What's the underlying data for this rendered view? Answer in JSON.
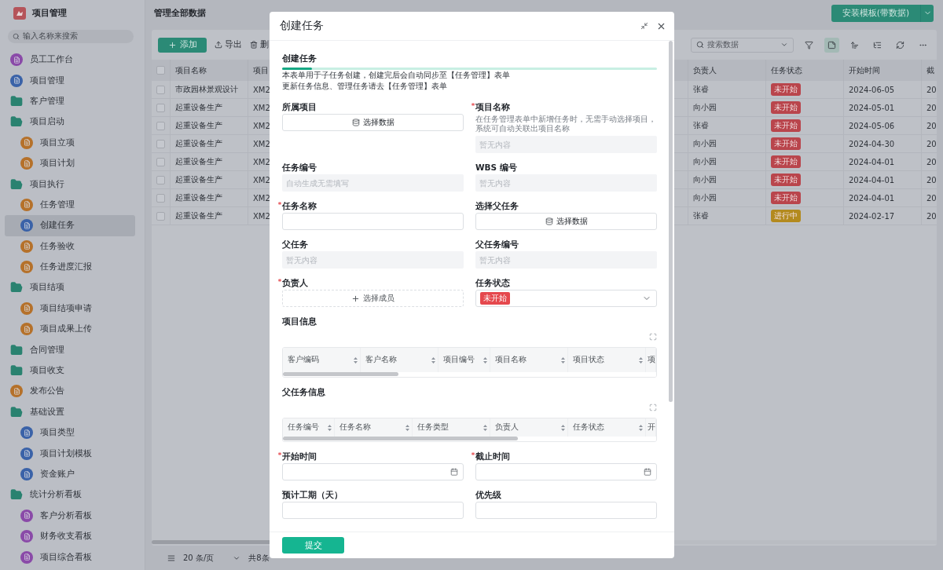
{
  "sidebar": {
    "title": "项目管理",
    "search": {
      "placeholder": "输入名称来搜索"
    },
    "items": [
      {
        "kind": "page",
        "label": "员工工作台",
        "color": "#8a4aa8",
        "selected": false
      },
      {
        "kind": "page",
        "label": "项目管理",
        "color": "#3a62a8",
        "selected": false
      },
      {
        "kind": "folder",
        "label": "客户管理",
        "expanded": false,
        "selected": false
      },
      {
        "kind": "folder",
        "label": "项目启动",
        "expanded": true,
        "selected": false,
        "children": [
          {
            "kind": "page",
            "label": "项目立项",
            "color": "#b5712a",
            "selected": false
          },
          {
            "kind": "page",
            "label": "项目计划",
            "color": "#b5712a",
            "selected": false
          }
        ]
      },
      {
        "kind": "folder",
        "label": "项目执行",
        "expanded": true,
        "selected": false,
        "children": [
          {
            "kind": "page",
            "label": "任务管理",
            "color": "#b5712a",
            "selected": false
          },
          {
            "kind": "page",
            "label": "创建任务",
            "color": "#3a62a8",
            "selected": true
          },
          {
            "kind": "page",
            "label": "任务验收",
            "color": "#b5712a",
            "selected": false
          },
          {
            "kind": "page",
            "label": "任务进度汇报",
            "color": "#b5712a",
            "selected": false
          }
        ]
      },
      {
        "kind": "folder",
        "label": "项目结项",
        "expanded": true,
        "selected": false,
        "children": [
          {
            "kind": "page",
            "label": "项目结项申请",
            "color": "#b5712a",
            "selected": false
          },
          {
            "kind": "page",
            "label": "项目成果上传",
            "color": "#b5712a",
            "selected": false
          }
        ]
      },
      {
        "kind": "folder",
        "label": "合同管理",
        "expanded": false,
        "selected": false
      },
      {
        "kind": "folder",
        "label": "项目收支",
        "expanded": false,
        "selected": false
      },
      {
        "kind": "page",
        "label": "发布公告",
        "color": "#b5712a",
        "selected": false
      },
      {
        "kind": "folder",
        "label": "基础设置",
        "expanded": true,
        "selected": false,
        "children": [
          {
            "kind": "page",
            "label": "项目类型",
            "color": "#3a62a8",
            "selected": false
          },
          {
            "kind": "page",
            "label": "项目计划模板",
            "color": "#3a62a8",
            "selected": false
          },
          {
            "kind": "page",
            "label": "资金账户",
            "color": "#3a62a8",
            "selected": false
          }
        ]
      },
      {
        "kind": "folder",
        "label": "统计分析看板",
        "expanded": true,
        "selected": false,
        "children": [
          {
            "kind": "page",
            "label": "客户分析看板",
            "color": "#8a4aa8",
            "selected": false
          },
          {
            "kind": "page",
            "label": "财务收支看板",
            "color": "#8a4aa8",
            "selected": false
          },
          {
            "kind": "page",
            "label": "项目综合看板",
            "color": "#8a4aa8",
            "selected": false
          }
        ]
      }
    ]
  },
  "header": {
    "title": "管理全部数据",
    "install_button": "安装模板(带数据)"
  },
  "toolbar": {
    "add": "添加",
    "export": "导出",
    "delete": "删",
    "search": {
      "placeholder": "搜索数据"
    },
    "view_toggle": {
      "on": true
    }
  },
  "table": {
    "header_checkbox": {
      "checked": false
    },
    "columns": [
      "项目名称",
      "项目",
      "负责人",
      "任务状态",
      "开始时间",
      "截"
    ],
    "rows": [
      {
        "checked": false,
        "name": "市政园林景观设计",
        "code": "XM2",
        "owner": "张睿",
        "status": {
          "text": "未开始",
          "color": "#b9454c"
        },
        "start": "2024-06-05",
        "end": "20"
      },
      {
        "checked": false,
        "name": "起重设备生产",
        "code": "XM2",
        "owner": "向小园",
        "status": {
          "text": "未开始",
          "color": "#b9454c"
        },
        "start": "2024-05-01",
        "end": "20"
      },
      {
        "checked": false,
        "name": "起重设备生产",
        "code": "XM2",
        "owner": "张睿",
        "status": {
          "text": "未开始",
          "color": "#b9454c"
        },
        "start": "2024-05-06",
        "end": "20"
      },
      {
        "checked": false,
        "name": "起重设备生产",
        "code": "XM2",
        "owner": "向小园",
        "status": {
          "text": "未开始",
          "color": "#b9454c"
        },
        "start": "2024-04-30",
        "end": "20"
      },
      {
        "checked": false,
        "name": "起重设备生产",
        "code": "XM2",
        "owner": "向小园",
        "status": {
          "text": "未开始",
          "color": "#b9454c"
        },
        "start": "2024-04-01",
        "end": "20"
      },
      {
        "checked": false,
        "name": "起重设备生产",
        "code": "XM2",
        "owner": "向小园",
        "status": {
          "text": "未开始",
          "color": "#b9454c"
        },
        "start": "2024-04-01",
        "end": "20"
      },
      {
        "checked": false,
        "name": "起重设备生产",
        "code": "XM2",
        "owner": "向小园",
        "status": {
          "text": "未开始",
          "color": "#b9454c"
        },
        "start": "2024-04-01",
        "end": "20"
      },
      {
        "checked": false,
        "name": "起重设备生产",
        "code": "XM2",
        "owner": "张睿",
        "status": {
          "text": "进行中",
          "color": "#b38a1e"
        },
        "start": "2024-02-17",
        "end": "20"
      }
    ]
  },
  "pagination": {
    "page_size": "20 条/页",
    "total": "共8条"
  },
  "dialog": {
    "title": "创建任务",
    "section": "创建任务",
    "description": [
      "本表单用于子任务创建，创建完后会自动同步至【任务管理】表单",
      "更新任务信息、管理任务请去【任务管理】表单"
    ],
    "fields": [
      {
        "kind": "picker",
        "label": "所属项目",
        "required": false,
        "button": "选择数据"
      },
      {
        "kind": "readonly",
        "label": "项目名称",
        "required": true,
        "hint": "在任务管理表单中新增任务时，无需手动选择项目，系统可自动关联出项目名称",
        "placeholder": "暂无内容"
      },
      {
        "kind": "readonly",
        "label": "任务编号",
        "required": false,
        "placeholder": "自动生成无需填写"
      },
      {
        "kind": "readonly",
        "label": "WBS 编号",
        "required": false,
        "placeholder": "暂无内容"
      },
      {
        "kind": "input",
        "label": "任务名称",
        "required": true
      },
      {
        "kind": "picker",
        "label": "选择父任务",
        "required": false,
        "button": "选择数据"
      },
      {
        "kind": "readonly",
        "label": "父任务",
        "required": false,
        "placeholder": "暂无内容"
      },
      {
        "kind": "readonly",
        "label": "父任务编号",
        "required": false,
        "placeholder": "暂无内容"
      },
      {
        "kind": "member",
        "label": "负责人",
        "required": true,
        "button": "选择成员"
      },
      {
        "kind": "status",
        "label": "任务状态",
        "required": false,
        "value": {
          "text": "未开始",
          "color": "#e5484d"
        }
      },
      {
        "kind": "subtable",
        "label": "项目信息",
        "required": false,
        "columns": [
          "客户编码",
          "客户名称",
          "项目编号",
          "项目名称",
          "项目状态",
          "项"
        ]
      },
      {
        "kind": "subtable",
        "label": "父任务信息",
        "required": false,
        "columns": [
          "任务编号",
          "任务名称",
          "任务类型",
          "负责人",
          "任务状态",
          "开"
        ]
      },
      {
        "kind": "date",
        "label": "开始时间",
        "required": true
      },
      {
        "kind": "date",
        "label": "截止时间",
        "required": true
      },
      {
        "kind": "input",
        "label": "预计工期（天）",
        "required": false
      },
      {
        "kind": "input",
        "label": "优先级",
        "required": false
      }
    ],
    "submit": "提交"
  }
}
